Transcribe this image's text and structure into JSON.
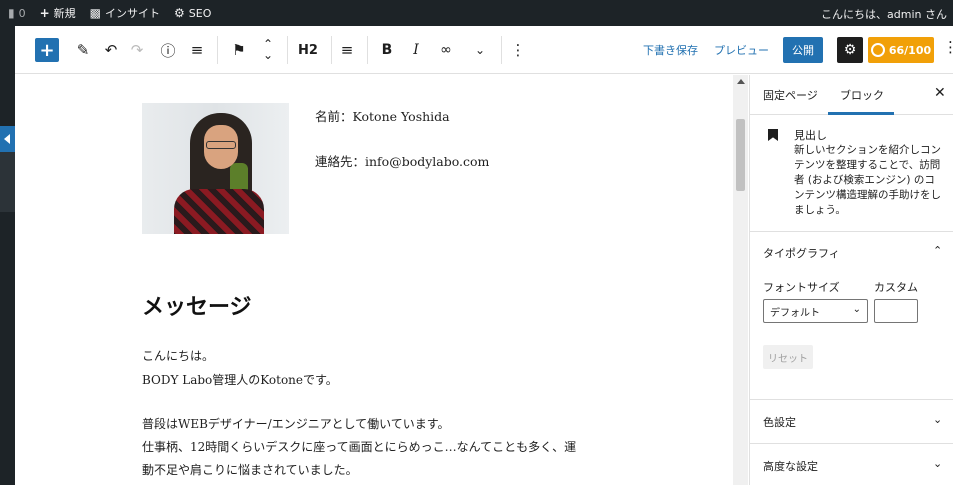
{
  "admin_bar": {
    "comments_count": "0",
    "new_label": "新規",
    "insight_label": "インサイト",
    "seo_label": "SEO",
    "greeting": "こんにちは、admin さん"
  },
  "toolbar": {
    "heading_level": "H2",
    "bold": "B",
    "italic": "I",
    "save_draft": "下書き保存",
    "preview": "プレビュー",
    "publish": "公開",
    "seo_score": "66/100"
  },
  "content": {
    "name_line": "名前：Kotone Yoshida",
    "contact_line": "連絡先：info@bodylabo.com",
    "heading": "メッセージ",
    "paragraphs": [
      "こんにちは。",
      "BODY Labo管理人のKotoneです。",
      "普段はWEBデザイナー/エンジニアとして働いています。",
      "仕事柄、12時間くらいデスクに座って画面とにらめっこ…なんてことも多く、運",
      "動不足や肩こりに悩まされていました。"
    ]
  },
  "sidebar": {
    "tab_page": "固定ページ",
    "tab_block": "ブロック",
    "block_title": "見出し",
    "block_description": "新しいセクションを紹介しコンテンツを整理することで、訪問者 (および検索エンジン) のコンテンツ構造理解の手助けをしましょう。",
    "typography_title": "タイポグラフィ",
    "font_size_label": "フォントサイズ",
    "custom_label": "カスタム",
    "font_size_value": "デフォルト",
    "reset_label": "リセット",
    "color_settings": "色設定",
    "advanced_settings": "高度な設定"
  },
  "colors": {
    "accent": "#2271b1",
    "seo_badge": "#f1a008",
    "admin_bar": "#1d2327"
  }
}
